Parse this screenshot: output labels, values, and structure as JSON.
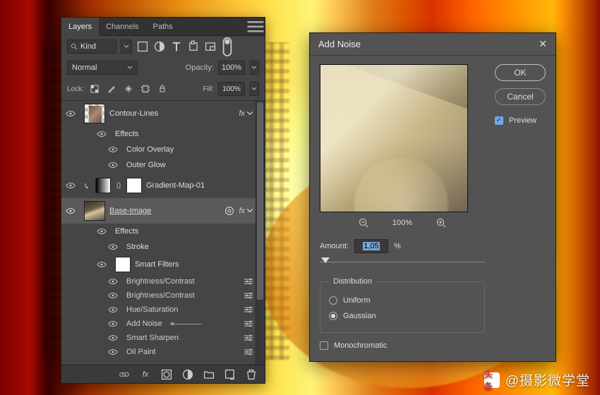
{
  "panel": {
    "tabs": [
      "Layers",
      "Channels",
      "Paths"
    ],
    "activeTab": 0,
    "filterKind": "Kind",
    "blendMode": "Normal",
    "opacityLabel": "Opacity:",
    "opacityValue": "100%",
    "lockLabel": "Lock:",
    "fillLabel": "Fill:",
    "fillValue": "100%",
    "layers": [
      {
        "name": "Contour-Lines",
        "hasFx": true,
        "effectsLabel": "Effects",
        "effects": [
          "Color Overlay",
          "Outer Glow"
        ]
      },
      {
        "name": "Gradient-Map-01",
        "clipped": true
      },
      {
        "name": "Base-Image",
        "selected": true,
        "smartObject": true,
        "hasFx": true,
        "effectsLabel": "Effects",
        "effects": [
          "Stroke"
        ],
        "smartFiltersLabel": "Smart Filters",
        "smartFilters": [
          "Brightness/Contrast",
          "Brightness/Contrast",
          "Hue/Saturation",
          "Add Noise",
          "Smart Sharpen",
          "Oil Paint"
        ],
        "highlightFilterIndex": 3
      }
    ]
  },
  "dialog": {
    "title": "Add Noise",
    "okLabel": "OK",
    "cancelLabel": "Cancel",
    "previewLabel": "Preview",
    "previewChecked": true,
    "zoomLevel": "100%",
    "amountLabel": "Amount:",
    "amountValue": "1,05",
    "amountUnit": "%",
    "distributionLabel": "Distribution",
    "uniformLabel": "Uniform",
    "gaussianLabel": "Gaussian",
    "distributionSelected": "gaussian",
    "monochromaticLabel": "Monochromatic",
    "monochromaticChecked": false
  },
  "watermark": {
    "brand": "头条",
    "text": "@摄影微学堂"
  }
}
